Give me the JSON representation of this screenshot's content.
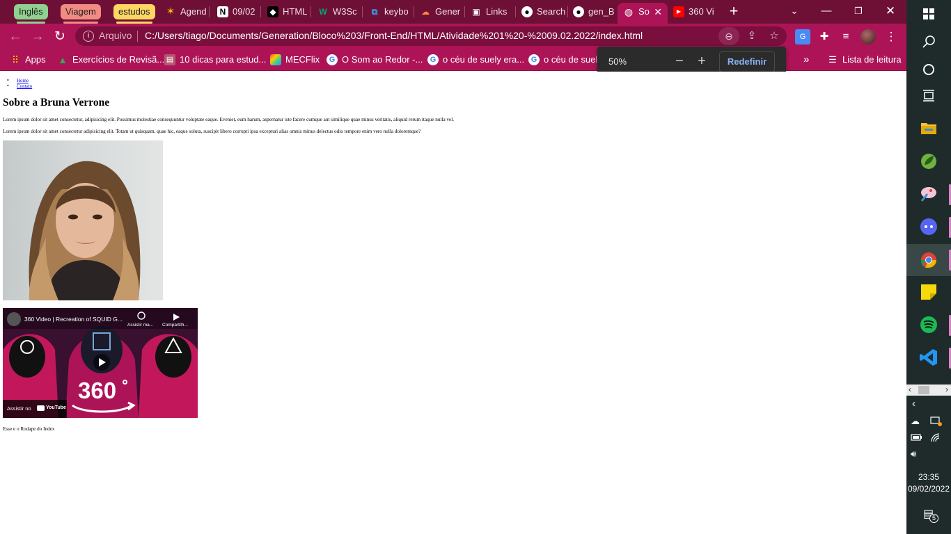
{
  "browser": {
    "tab_groups": [
      {
        "label": "Inglês",
        "color": "#8fd18f"
      },
      {
        "label": "Viagem",
        "color": "#f28b82"
      },
      {
        "label": "estudos",
        "color": "#fdd663"
      }
    ],
    "tabs": [
      {
        "label": "Agend",
        "icon": "star-icon"
      },
      {
        "label": "09/02",
        "icon": "notion-icon"
      },
      {
        "label": "HTML",
        "icon": "html-icon"
      },
      {
        "label": "W3Sc",
        "icon": "w3schools-icon"
      },
      {
        "label": "keybo",
        "icon": "vscode-icon"
      },
      {
        "label": "Gener",
        "icon": "cloud-icon"
      },
      {
        "label": "Links",
        "icon": "floppy-icon"
      },
      {
        "label": "Search",
        "icon": "github-icon"
      },
      {
        "label": "gen_B",
        "icon": "github-icon"
      },
      {
        "label": "So",
        "icon": "globe-icon",
        "active": true
      },
      {
        "label": "360 Vi",
        "icon": "youtube-icon"
      }
    ],
    "omnibox": {
      "scheme_label": "Arquivo",
      "url": "C:/Users/tiago/Documents/Generation/Bloco%203/Front-End/HTML/Atividade%201%20-%2009.02.2022/index.html"
    },
    "bookmarks": [
      {
        "label": "Apps",
        "icon": "apps-grid-icon"
      },
      {
        "label": "Exercícios de Revisã...",
        "icon": "drive-icon"
      },
      {
        "label": "10 dicas para estud...",
        "icon": "book-icon"
      },
      {
        "label": "MECFlix",
        "icon": "mecflix-icon"
      },
      {
        "label": "O Som ao Redor -...",
        "icon": "google-icon"
      },
      {
        "label": "o céu de suely era...",
        "icon": "google-icon"
      },
      {
        "label": "o céu de suely",
        "icon": "google-icon"
      }
    ],
    "reading_list_label": "Lista de leitura",
    "zoom_popup": {
      "percent": "50%",
      "reset_label": "Redefinir"
    }
  },
  "page": {
    "nav_links": [
      "Home",
      "Contato"
    ],
    "title": "Sobre a Bruna Verrone",
    "paragraph1": "Lorem ipsum dolor sit amet consectetur, adipisicing elit. Possimus molestiae consequuntur voluptate eaque. Eveniet, eum harum, aspernatur iste facere cumque aut similique quae minus veritatis, aliquid rerum itaque nulla vel.",
    "paragraph2": "Lorem ipsum dolor sit amet consectetur adipisicing elit. Totam ut quisquam, quae hic, eaque soluta, suscipit libero corrupti ipsa excepturi alias omnis minus delectus odio tempore enim vero nulla doloremque?",
    "video": {
      "title": "360 Video | Recreation of SQUID G...",
      "watch_later": "Assistir ma...",
      "share": "Compartilh...",
      "watch_on": "Assistir no",
      "youtube": "YouTube",
      "badge": "360"
    },
    "footer": "Esse e o Rodape do Index"
  },
  "taskbar": {
    "time": "23:35",
    "date": "09/02/2022",
    "notifications": "5"
  }
}
